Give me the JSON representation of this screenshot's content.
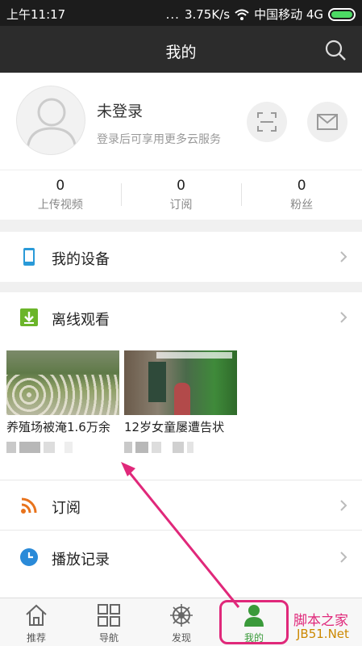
{
  "status_bar": {
    "time": "上午11:17",
    "dots": "...",
    "network_speed": "3.75K/s",
    "carrier": "中国移动 4G"
  },
  "header": {
    "title": "我的",
    "search_icon": "search-icon"
  },
  "profile": {
    "name": "未登录",
    "subtitle": "登录后可享用更多云服务",
    "scan_icon": "scan-icon",
    "mail_icon": "mail-icon"
  },
  "stats": [
    {
      "count": "0",
      "label": "上传视频"
    },
    {
      "count": "0",
      "label": "订阅"
    },
    {
      "count": "0",
      "label": "粉丝"
    }
  ],
  "menu": {
    "devices": "我的设备",
    "offline": "离线观看",
    "subscribe": "订阅",
    "history": "播放记录"
  },
  "offline_videos": [
    {
      "title": "养殖场被淹1.6万余"
    },
    {
      "title": "12岁女童屡遭告状"
    }
  ],
  "tabs": [
    {
      "label": "推荐",
      "icon": "home-icon"
    },
    {
      "label": "导航",
      "icon": "grid-icon"
    },
    {
      "label": "发现",
      "icon": "wheel-icon"
    },
    {
      "label": "我的",
      "icon": "user-icon"
    }
  ],
  "watermark": {
    "line1": "脚本之家",
    "line2": "JB51.Net"
  },
  "colors": {
    "accent_green": "#3a9a3a",
    "highlight_pink": "#e0287a"
  }
}
